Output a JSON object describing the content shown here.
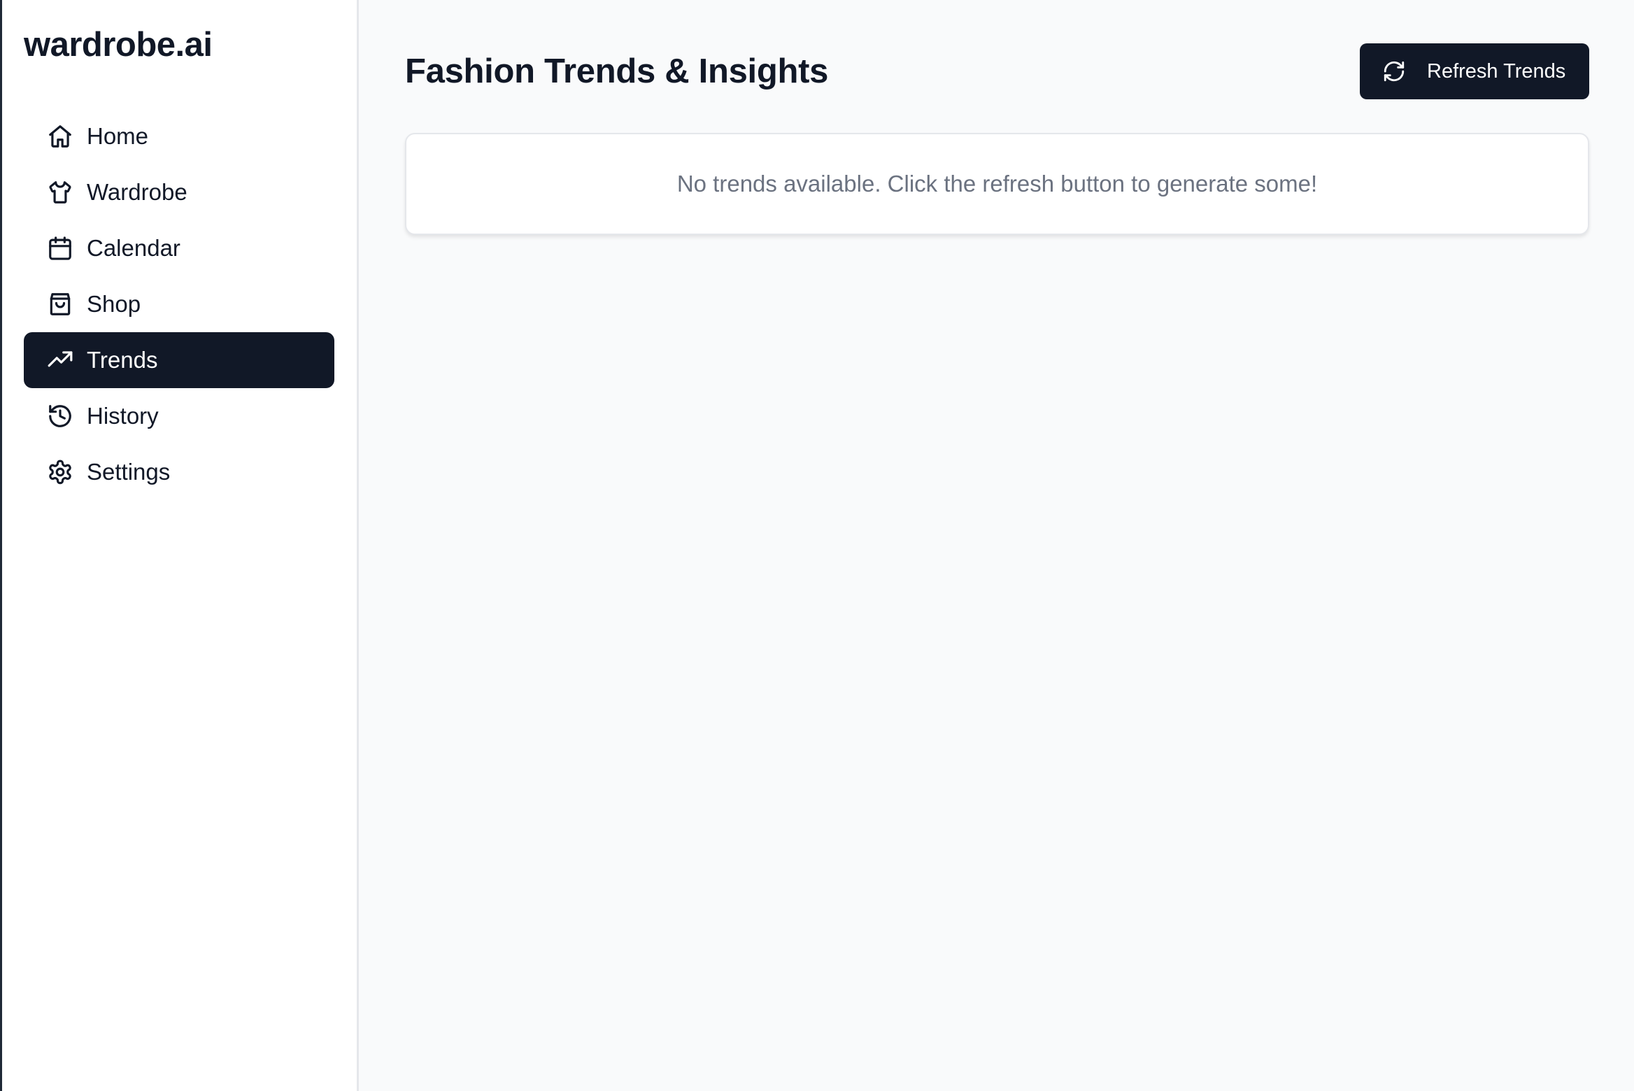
{
  "brand": {
    "name": "wardrobe.ai"
  },
  "sidebar": {
    "items": [
      {
        "label": "Home",
        "icon": "home-icon",
        "active": false
      },
      {
        "label": "Wardrobe",
        "icon": "shirt-icon",
        "active": false
      },
      {
        "label": "Calendar",
        "icon": "calendar-icon",
        "active": false
      },
      {
        "label": "Shop",
        "icon": "shopping-bag-icon",
        "active": false
      },
      {
        "label": "Trends",
        "icon": "trending-up-icon",
        "active": true
      },
      {
        "label": "History",
        "icon": "history-icon",
        "active": false
      },
      {
        "label": "Settings",
        "icon": "gear-icon",
        "active": false
      }
    ]
  },
  "main": {
    "title": "Fashion Trends & Insights",
    "refresh_button": {
      "label": "Refresh Trends",
      "icon": "refresh-icon"
    },
    "empty_state": {
      "message": "No trends available. Click the refresh button to generate some!"
    }
  },
  "colors": {
    "primary": "#111827",
    "background": "#f9fafb",
    "muted_text": "#6b7280",
    "border": "#e5e7eb"
  }
}
